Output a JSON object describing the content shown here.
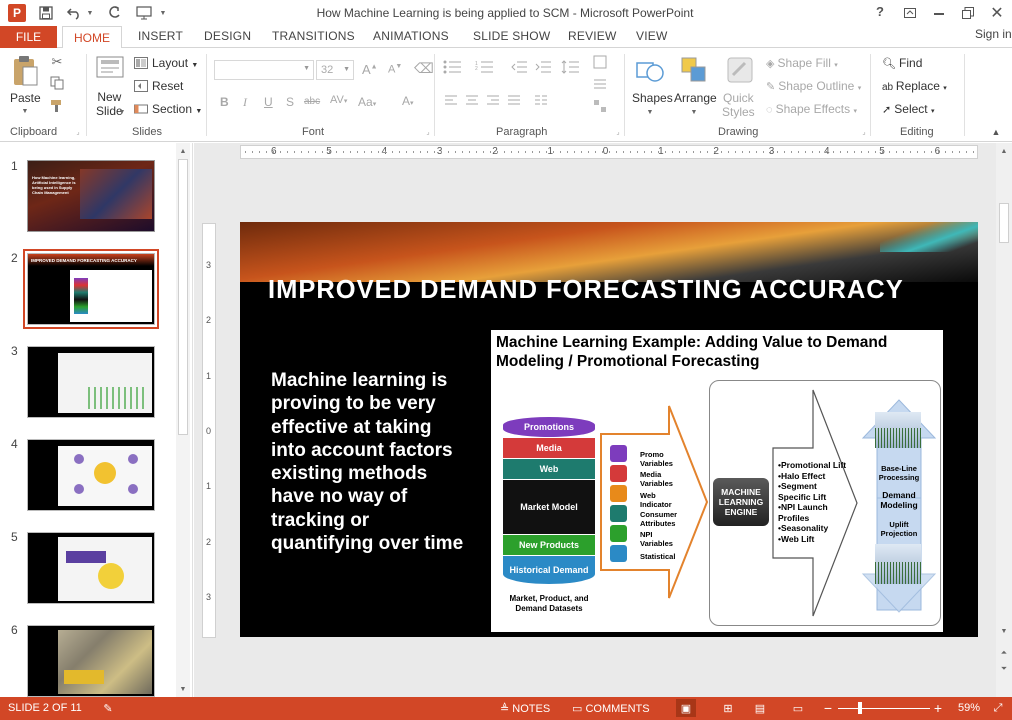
{
  "window": {
    "title": "How Machine Learning is being applied to SCM - Microsoft PowerPoint",
    "help": "?",
    "account": "Sign in"
  },
  "tabs": [
    "FILE",
    "HOME",
    "INSERT",
    "DESIGN",
    "TRANSITIONS",
    "ANIMATIONS",
    "SLIDE SHOW",
    "REVIEW",
    "VIEW"
  ],
  "ribbon": {
    "clipboard": {
      "label": "Clipboard",
      "paste": "Paste"
    },
    "slides": {
      "label": "Slides",
      "new_slide": "New\nSlide",
      "layout": "Layout",
      "reset": "Reset",
      "section": "Section"
    },
    "font": {
      "label": "Font",
      "font_size": "32"
    },
    "paragraph": {
      "label": "Paragraph"
    },
    "drawing": {
      "label": "Drawing",
      "shapes": "Shapes",
      "arrange": "Arrange",
      "quick_styles": "Quick\nStyles",
      "shape_fill": "Shape Fill",
      "shape_outline": "Shape Outline",
      "shape_effects": "Shape Effects"
    },
    "editing": {
      "label": "Editing",
      "find": "Find",
      "replace": "Replace",
      "select": "Select"
    }
  },
  "ruler": {
    "labels": [
      "6",
      "5",
      "4",
      "3",
      "2",
      "1",
      "0",
      "1",
      "2",
      "3",
      "4",
      "5",
      "6"
    ]
  },
  "vruler": {
    "labels": [
      "3",
      "2",
      "1",
      "0",
      "1",
      "2",
      "3"
    ]
  },
  "thumbnails": [
    {
      "num": "1",
      "title": "How Machine learning, Artificial Intelligence is being used in Supply Chain Management"
    },
    {
      "num": "2",
      "title": "IMPROVED DEMAND FORECASTING ACCURACY"
    },
    {
      "num": "3"
    },
    {
      "num": "4"
    },
    {
      "num": "5"
    },
    {
      "num": "6"
    }
  ],
  "slide": {
    "title": "IMPROVED DEMAND FORECASTING ACCURACY",
    "body": "Machine learning is proving to be very effective at taking into account factors existing methods have no way of tracking or quantifying over time",
    "figure": {
      "title": "Machine Learning Example: Adding Value to Demand Modeling / Promotional Forecasting",
      "db_layers": [
        "Promotions",
        "Media",
        "Web",
        "Market Model",
        "New Products",
        "Historical Demand"
      ],
      "db_caption": "Market, Product, and Demand Datasets",
      "variables": [
        "Promo Variables",
        "Media Variables",
        "Web Indicator",
        "Consumer Attributes",
        "NPI Variables",
        "Statistical"
      ],
      "engine": "MACHINE LEARNING ENGINE",
      "outputs": [
        "•Promotional Lift",
        "•Halo Effect",
        "•Segment Specific Lift",
        "•NPI Launch Profiles",
        "•Seasonality",
        "•Web Lift"
      ],
      "base_line": "Base-Line Processing",
      "demand_modeling": "Demand Modeling",
      "uplift": "Uplift Projection"
    }
  },
  "status": {
    "slide": "SLIDE 2 OF 11",
    "notes": "NOTES",
    "comments": "COMMENTS",
    "zoom": "59%"
  },
  "colors": {
    "accent": "#d24726",
    "title_text": "#ffffff"
  }
}
